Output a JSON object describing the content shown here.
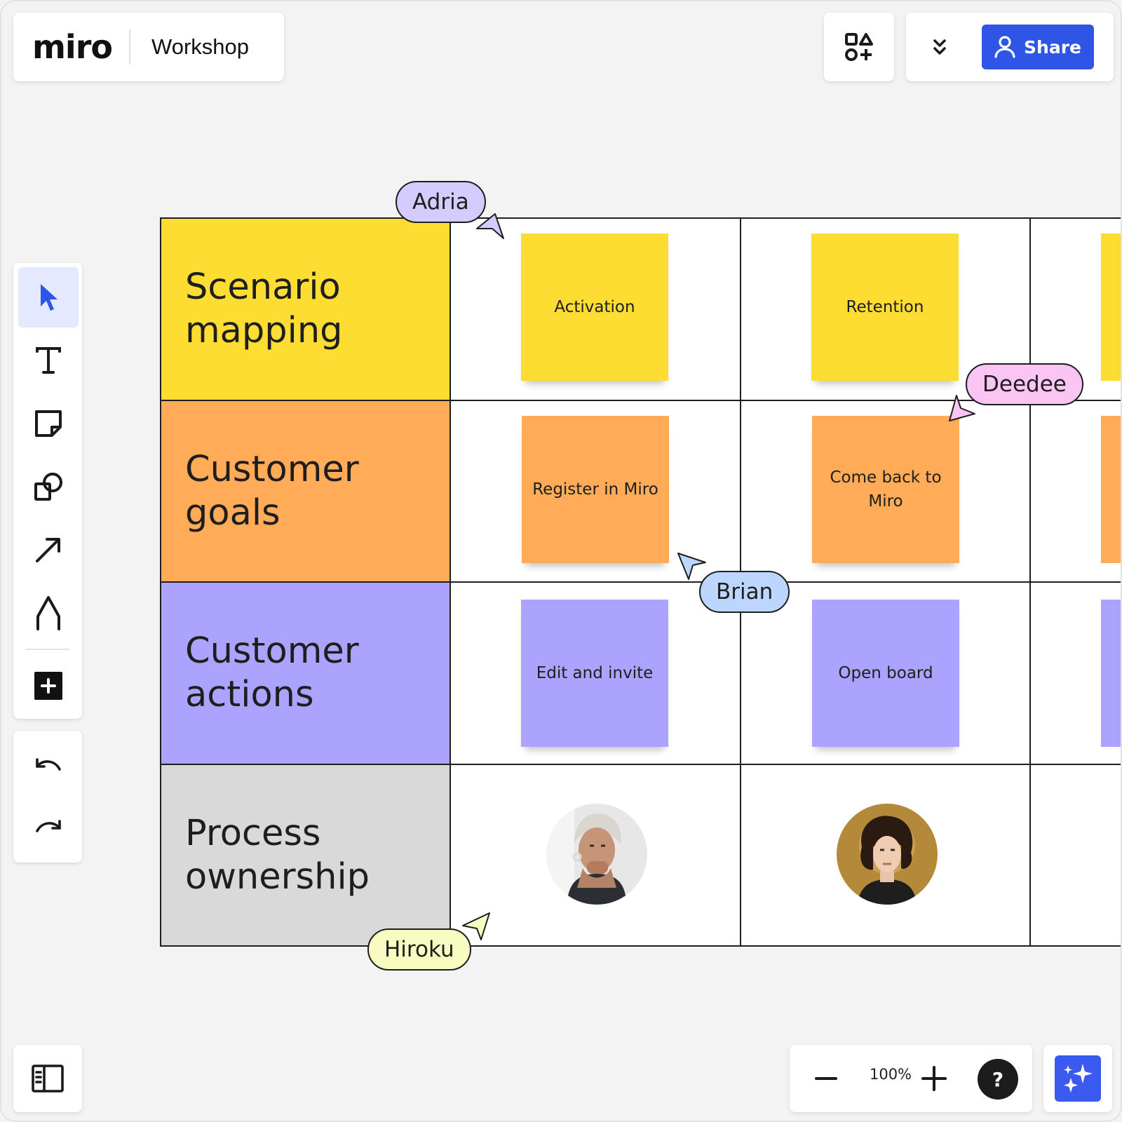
{
  "header": {
    "logo": "miro",
    "board_name": "Workshop",
    "share_label": "Share",
    "icons": {
      "shapes": "shapes-library-icon",
      "collapse": "chevrons-down-icon",
      "share": "user-icon"
    }
  },
  "toolbar": {
    "tools": [
      {
        "name": "select-tool",
        "icon": "cursor-arrow-icon",
        "active": true
      },
      {
        "name": "text-tool",
        "icon": "text-icon"
      },
      {
        "name": "sticky-note-tool",
        "icon": "sticky-note-icon"
      },
      {
        "name": "shapes-tool",
        "icon": "shapes-icon"
      },
      {
        "name": "connector-tool",
        "icon": "arrow-line-icon"
      },
      {
        "name": "pen-tool",
        "icon": "pen-icon"
      },
      {
        "name": "more-tools",
        "icon": "plus-square-icon"
      }
    ],
    "undo_icon": "undo-icon",
    "redo_icon": "redo-icon"
  },
  "board": {
    "rows": [
      {
        "title": "Scenario\nmapping",
        "color": "#fedd33"
      },
      {
        "title": "Customer\ngoals",
        "color": "#ffab57"
      },
      {
        "title": "Customer\nactions",
        "color": "#aba3fe"
      },
      {
        "title": "Process\nownership",
        "color": "#d9d9d9"
      }
    ],
    "stickies": [
      {
        "text": "Activation",
        "color": "#fedd33"
      },
      {
        "text": "Retention",
        "color": "#fedd33"
      },
      {
        "text": "Register in Miro",
        "color": "#ffab57"
      },
      {
        "text": "Come back to Miro",
        "color": "#ffab57"
      },
      {
        "text": "Edit and invite",
        "color": "#aba3fe"
      },
      {
        "text": "Open board",
        "color": "#aba3fe"
      }
    ],
    "cursors": [
      {
        "name": "Adria",
        "color": "#d4ccff"
      },
      {
        "name": "Deedee",
        "color": "#fac5f2"
      },
      {
        "name": "Brian",
        "color": "#bcd6ff"
      },
      {
        "name": "Hiroku",
        "color": "#f8fcc0"
      }
    ]
  },
  "bottom": {
    "zoom_level": "100%",
    "help_label": "?",
    "icons": {
      "sidebar": "board-sidebar-icon",
      "zoom_out": "minus-icon",
      "zoom_in": "plus-icon",
      "ai": "sparkles-icon"
    }
  }
}
